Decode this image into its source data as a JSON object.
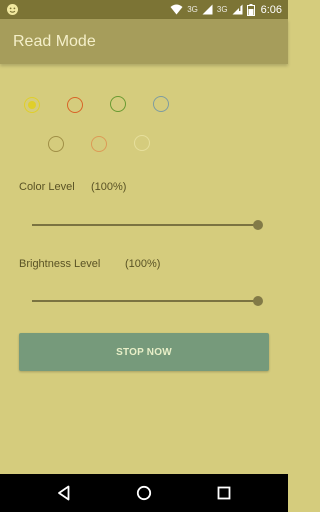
{
  "status_bar": {
    "network_label": "3G",
    "time": "6:06",
    "icons": [
      "notification-icon",
      "wifi-icon",
      "cellular-icon",
      "battery-icon"
    ]
  },
  "app_bar": {
    "title": "Read Mode"
  },
  "color_swatches": [
    {
      "name": "yellow",
      "color": "#e0cf2a",
      "selected": true
    },
    {
      "name": "red",
      "color": "#d86428",
      "selected": false
    },
    {
      "name": "green",
      "color": "#6a9a32",
      "selected": false
    },
    {
      "name": "blue",
      "color": "#7e9ca0",
      "selected": false
    },
    {
      "name": "olive",
      "color": "#a08f46",
      "selected": false
    },
    {
      "name": "orange",
      "color": "#dc9a56",
      "selected": false
    },
    {
      "name": "pale-yellow",
      "color": "#e6df9c",
      "selected": false
    }
  ],
  "color_level": {
    "label": "Color Level",
    "value_text": "(100%)",
    "value": 1.0
  },
  "brightness_level": {
    "label": "Brightness Level",
    "value_text": "(100%)",
    "value": 1.0
  },
  "stop_button": {
    "label": "STOP NOW"
  },
  "colors": {
    "background": "#d5cc7d",
    "app_bar": "#a69d5b",
    "status_bar": "#7c7435",
    "button": "#769a7b"
  }
}
